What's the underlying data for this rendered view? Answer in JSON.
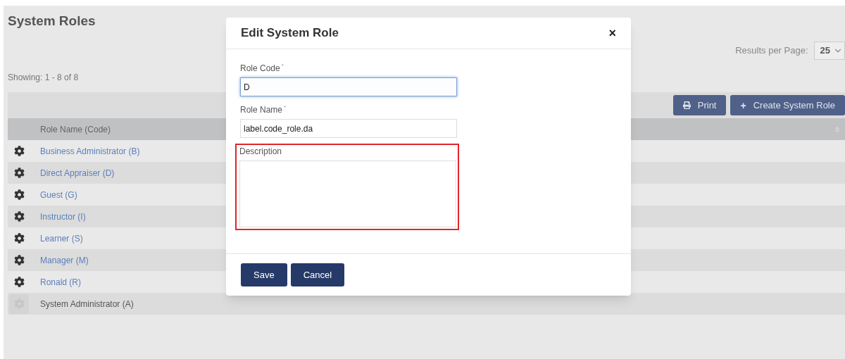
{
  "page": {
    "title": "System Roles",
    "results_per_page_label": "Results per Page:",
    "results_per_page": "25",
    "showing": "Showing: 1 - 8 of 8"
  },
  "toolbar": {
    "buttons": [
      {
        "kind": "print",
        "label": "Print"
      },
      {
        "kind": "create",
        "icon": "+",
        "label": "Create System Role"
      }
    ]
  },
  "table": {
    "columns": [
      "Role Name (Code)"
    ],
    "rows": [
      {
        "name": "Business Administrator (B)",
        "disabled": false
      },
      {
        "name": "Direct Appraiser (D)",
        "disabled": false
      },
      {
        "name": "Guest (G)",
        "disabled": false
      },
      {
        "name": "Instructor (I)",
        "disabled": false
      },
      {
        "name": "Learner (S)",
        "disabled": false
      },
      {
        "name": "Manager (M)",
        "disabled": false
      },
      {
        "name": "Ronald (R)",
        "disabled": false
      },
      {
        "name": "System Administrator (A)",
        "disabled": true
      }
    ]
  },
  "dialog": {
    "title": "Edit System Role",
    "close": "×",
    "fields": [
      {
        "kind": "input",
        "label": "Role Code",
        "required_mark": "*",
        "value": "D",
        "focused": true
      },
      {
        "kind": "input",
        "label": "Role Name",
        "required_mark": "*",
        "value": "label.code_role.da",
        "focused": false
      },
      {
        "kind": "textarea",
        "label": "Description",
        "highlighted": true
      }
    ],
    "buttons": [
      "Save",
      "Cancel"
    ]
  }
}
